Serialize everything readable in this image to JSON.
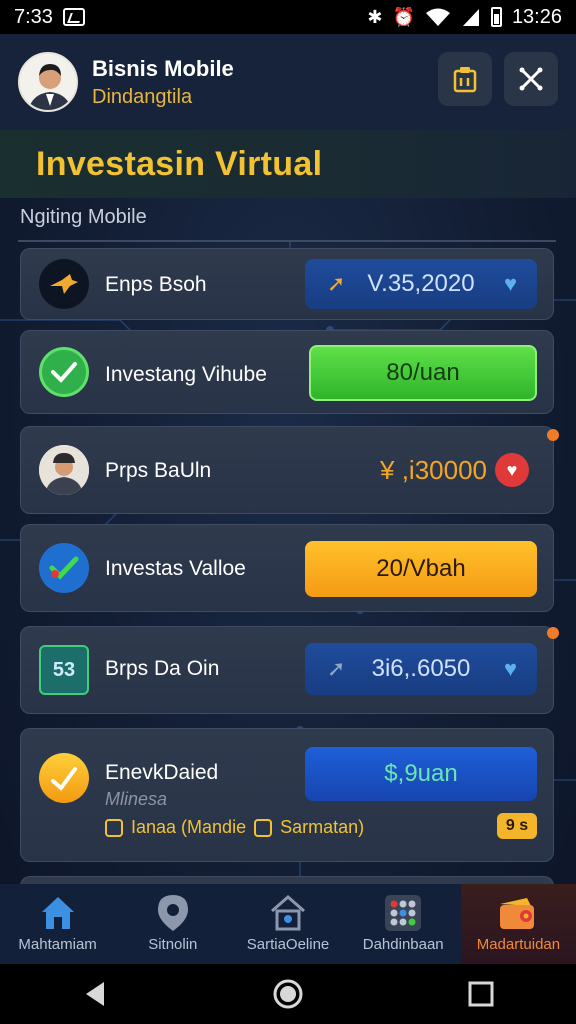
{
  "status_bar": {
    "time": "7:33",
    "right_time": "13:26",
    "icons": [
      "image-icon",
      "bluetooth-icon",
      "alarm-icon",
      "wifi-icon",
      "signal-icon",
      "battery-icon"
    ]
  },
  "header": {
    "title": "Bisnis Mobile",
    "subtitle": "Dindangtila",
    "avatar": "user-avatar",
    "buttons": [
      "clipboard-icon",
      "close-icon"
    ]
  },
  "banner": {
    "title": "Investasin Virtual"
  },
  "section": {
    "label": "Ngiting Mobile"
  },
  "cards": [
    {
      "label": "Enps Bsoh",
      "value": "V.35,2020",
      "icon": "fox-icon"
    },
    {
      "label": "Investang Vihube",
      "value": "80/uan",
      "icon": "check-circle-icon"
    },
    {
      "label": "Prps BaUln",
      "value": "¥ ,i30000",
      "icon": "person-avatar"
    },
    {
      "label": "Investas Valloe",
      "value": "20/Vbah",
      "icon": "check-globe-icon"
    },
    {
      "label": "Brps Da Oin",
      "value": "3i6,.6050",
      "badge_text": "53",
      "icon": "calendar-icon"
    },
    {
      "label": "EnevkDaied",
      "muted": "Mlinesa",
      "link_left": "Ianaa (Mandie",
      "link_right": "Sarmatan)",
      "value": "$,9uan",
      "mini_badge": "9 s",
      "icon": "coin-icon"
    }
  ],
  "bottom_nav": [
    {
      "label": "Mahtamiam",
      "icon": "home-icon"
    },
    {
      "label": "Sitnolin",
      "icon": "location-pin-icon"
    },
    {
      "label": "SartiaOeline",
      "icon": "house-network-icon"
    },
    {
      "label": "Dahdinbaan",
      "icon": "grid-dots-icon"
    },
    {
      "label": "Madartuidan",
      "icon": "wallet-icon",
      "active": true
    }
  ],
  "colors": {
    "accent_gold": "#f2c232",
    "green": "#3fcf36",
    "orange": "#f59a14",
    "blue": "#1f4c9c"
  }
}
